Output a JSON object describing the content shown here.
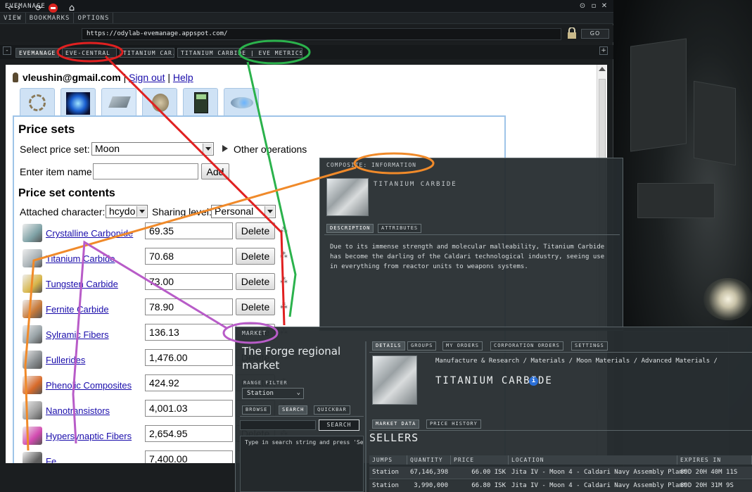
{
  "window": {
    "title": "EVEMANAGE"
  },
  "menu": [
    "VIEW",
    "BOOKMARKS",
    "OPTIONS"
  ],
  "address": {
    "url": "https://odylab-evemanage.appspot.com/",
    "go_label": "GO"
  },
  "tabs": [
    {
      "label": "EVEMANAGE"
    },
    {
      "label": "EVE-CENTRAL"
    },
    {
      "label": "TITANIUM CAR..."
    },
    {
      "label": "TITANIUM CARBIDE | EVE METRICS ..."
    }
  ],
  "page": {
    "account": {
      "email": "vleushin@gmail.com",
      "sign_out": "Sign out",
      "help": "Help",
      "sep": "|"
    },
    "price_sets_title": "Price sets",
    "select_price_set_label": "Select price set:",
    "price_set_value": "Moon",
    "other_operations": "Other operations",
    "enter_item_label": "Enter item name:",
    "enter_item_value": "",
    "add_label": "Add",
    "contents_title": "Price set contents",
    "attached_character_label": "Attached character:",
    "attached_character_value": "hcydo",
    "sharing_level_label": "Sharing level:",
    "sharing_level_value": "Personal",
    "delete_label": "Delete",
    "items": [
      {
        "name": "Crystalline Carbonide",
        "price": "69.35",
        "icon": "crystalline-carbonide-icon"
      },
      {
        "name": "Titanium Carbide",
        "price": "70.68",
        "icon": "titanium-carbide-icon"
      },
      {
        "name": "Tungsten Carbide",
        "price": "73.00",
        "icon": "tungsten-carbide-icon"
      },
      {
        "name": "Fernite Carbide",
        "price": "78.90",
        "icon": "fernite-carbide-icon"
      },
      {
        "name": "Sylramic Fibers",
        "price": "136.13",
        "icon": "sylramic-fibers-icon"
      },
      {
        "name": "Fullerides",
        "price": "1,476.00",
        "icon": "fullerides-icon"
      },
      {
        "name": "Phenolic Composites",
        "price": "424.92",
        "icon": "phenolic-composites-icon"
      },
      {
        "name": "Nanotransistors",
        "price": "4,001.03",
        "icon": "nanotransistors-icon"
      },
      {
        "name": "Hypersynaptic Fibers",
        "price": "2,654.95",
        "icon": "hypersynaptic-fibers-icon"
      },
      {
        "name": "Fe...",
        "price": "7,400.00",
        "icon": "ferrogel-icon"
      }
    ]
  },
  "info_window": {
    "header": "COMPOSITE: INFORMATION",
    "item_title": "TITANIUM CARBIDE",
    "tabs": [
      "DESCRIPTION",
      "ATTRIBUTES"
    ],
    "description": "Due to its immense strength and molecular malleability, Titanium Carbide has become the darling of the Caldari technological industry, seeing use in everything from reactor units to weapons systems."
  },
  "market": {
    "header": "MARKET",
    "title_line1": "The Forge regional",
    "title_line2": "market",
    "range_label": "RANGE FILTER",
    "range_value": "Station",
    "left_tabs": [
      "BROWSE",
      "SEARCH",
      "QUICKBAR"
    ],
    "search_button": "SEARCH",
    "search_hint": "Type in search string and press 'Se",
    "top_tabs": [
      "DETAILS",
      "GROUPS",
      "MY ORDERS",
      "CORPORATION ORDERS",
      "SETTINGS"
    ],
    "breadcrumb": "Manufacture & Research / Materials / Moon Materials / Advanced Materials /",
    "item_name": "TITANIUM CARBIDE",
    "data_tabs": [
      "MARKET DATA",
      "PRICE HISTORY"
    ],
    "sellers_title": "SELLERS",
    "columns": [
      "JUMPS",
      "QUANTITY",
      "PRICE",
      "LOCATION",
      "EXPIRES IN"
    ],
    "rows": [
      {
        "jumps": "Station",
        "quantity": "67,146,398",
        "price": "66.00 ISK",
        "location": "Jita IV - Moon 4 - Caldari Navy Assembly Plant",
        "expires": "89D 20H 40M 11S"
      },
      {
        "jumps": "Station",
        "quantity": "3,990,000",
        "price": "66.80 ISK",
        "location": "Jita IV - Moon 4 - Caldari Navy Assembly Plant",
        "expires": "89D 20H 31M 9S"
      }
    ]
  },
  "colors": {
    "annot_red": "#e02020",
    "annot_green": "#2bb24c",
    "annot_orange": "#f08a2a",
    "annot_purple": "#b85cc8",
    "link": "#1a0dab"
  }
}
